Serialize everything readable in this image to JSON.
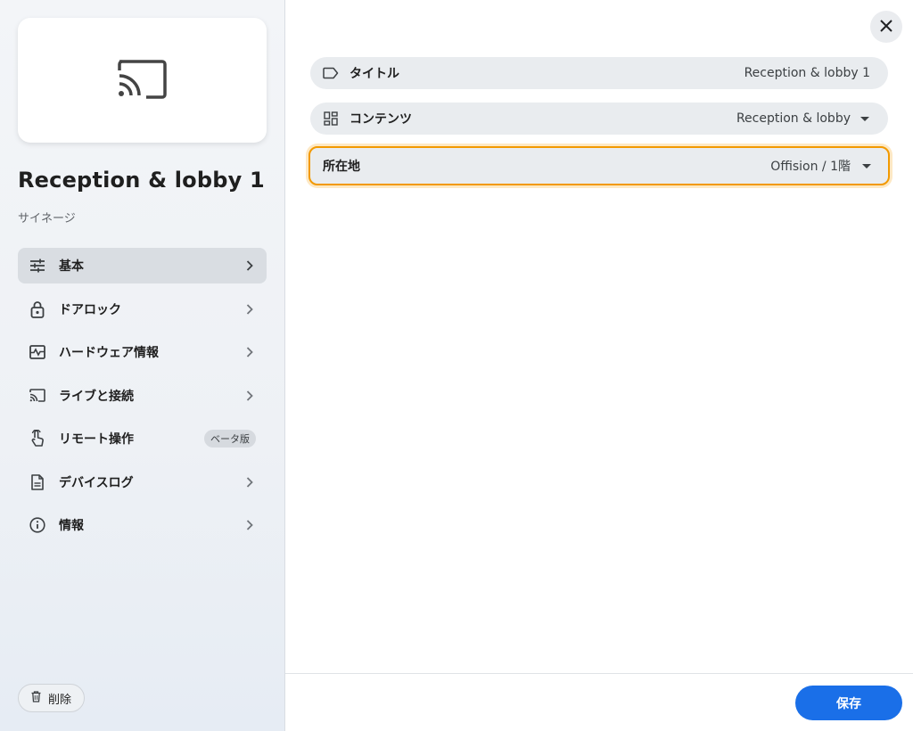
{
  "device": {
    "title": "Reception & lobby 1",
    "type": "サイネージ",
    "preview_icon": "cast-icon"
  },
  "sidebar": {
    "items": [
      {
        "label": "基本",
        "icon": "tune-icon",
        "active": true
      },
      {
        "label": "ドアロック",
        "icon": "lock-icon"
      },
      {
        "label": "ハードウェア情報",
        "icon": "monitor-heart-icon"
      },
      {
        "label": "ライブと接続",
        "icon": "cast-icon"
      },
      {
        "label": "リモート操作",
        "icon": "touch-icon",
        "badge": "ベータ版"
      },
      {
        "label": "デバイスログ",
        "icon": "document-icon"
      },
      {
        "label": "情報",
        "icon": "info-icon"
      }
    ],
    "delete_label": "削除"
  },
  "form": {
    "fields": [
      {
        "label": "タイトル",
        "value": "Reception & lobby 1",
        "icon": "label-icon"
      },
      {
        "label": "コンテンツ",
        "value": "Reception & lobby",
        "icon": "dashboard-icon"
      },
      {
        "label": "所在地",
        "value": "Offision / 1階"
      }
    ]
  },
  "footer": {
    "save_label": "保存"
  },
  "colors": {
    "accent": "#1a6fe8",
    "focus_ring": "#f29900"
  }
}
